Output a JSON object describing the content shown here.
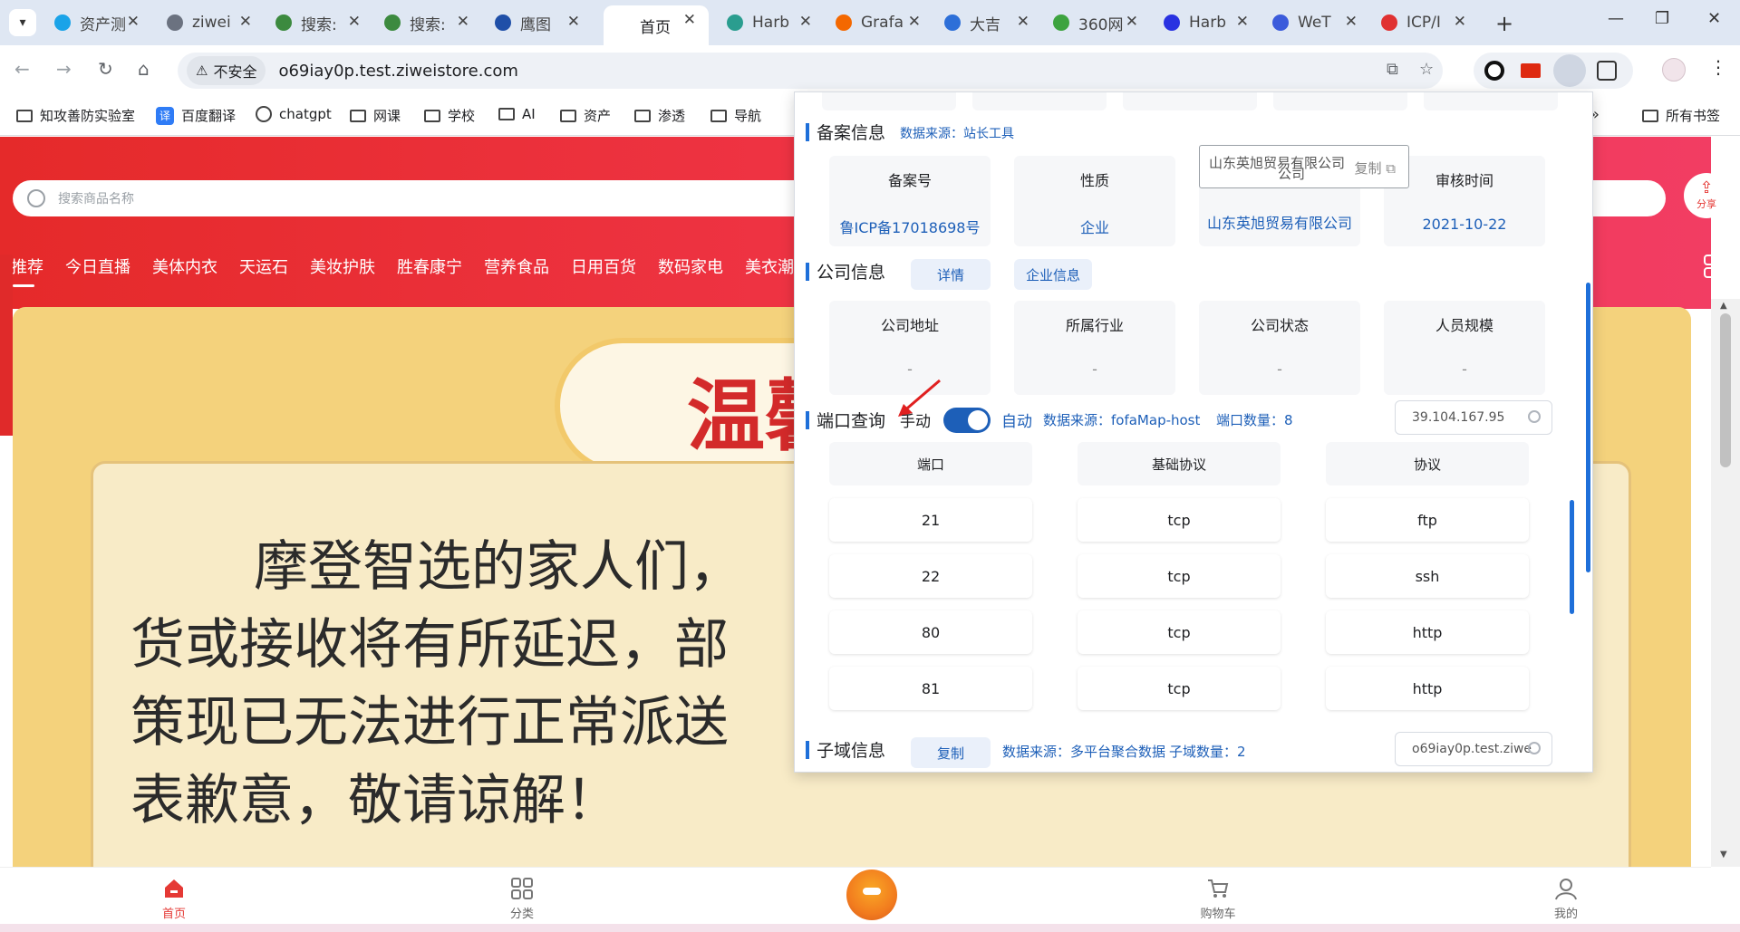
{
  "browser": {
    "tabs": [
      {
        "label": "资产测",
        "color": "#1aa3e8"
      },
      {
        "label": "ziwei",
        "color": "#6b7280"
      },
      {
        "label": "搜索:",
        "color": "#3c8a3f"
      },
      {
        "label": "搜索:",
        "color": "#3c8a3f"
      },
      {
        "label": "鹰图",
        "color": "#1f4fa8"
      },
      {
        "label": "首页",
        "color": "#ffffff"
      },
      {
        "label": "Harb",
        "color": "#2a9d8f"
      },
      {
        "label": "Grafa",
        "color": "#f46800"
      },
      {
        "label": "大吉",
        "color": "#2d6fd8"
      },
      {
        "label": "360网",
        "color": "#3da33f"
      },
      {
        "label": "Harb",
        "color": "#2932e1"
      },
      {
        "label": "WeT",
        "color": "#3b5bdb"
      },
      {
        "label": "ICP/I",
        "color": "#e03131"
      }
    ],
    "address": {
      "insecure_label": "不安全",
      "url": "o69iay0p.test.ziweistore.com"
    },
    "bookmarks": [
      "知攻善防实验室",
      "百度翻译",
      "chatgpt",
      "网课",
      "学校",
      "AI",
      "资产",
      "渗透",
      "导航"
    ],
    "bookmark_badge": "译",
    "all_bookmarks": "所有书签"
  },
  "page": {
    "search_placeholder": "搜索商品名称",
    "share_label": "分享",
    "categories": [
      "推荐",
      "今日直播",
      "美体内衣",
      "天运石",
      "美妆护肤",
      "胜春康宁",
      "营养食品",
      "日用百货",
      "数码家电",
      "美衣潮服"
    ],
    "banner": {
      "title_partial": "温馨",
      "lines": [
        "摩登智选的家人们，",
        "货或接收将有所延迟，部",
        "策现已无法进行正常派送",
        "表歉意，敬请谅解！"
      ]
    },
    "bottom_nav": [
      {
        "label": "首页",
        "active": true
      },
      {
        "label": "分类",
        "active": false
      },
      {
        "label": "购物车",
        "active": false
      },
      {
        "label": "我的",
        "active": false
      }
    ]
  },
  "popup": {
    "beian": {
      "title": "备案信息",
      "source": "数据来源：站长工具",
      "headers": [
        "备案号",
        "性质",
        "",
        "审核时间"
      ],
      "values": [
        "鲁ICP备17018698号",
        "企业",
        "山东英旭贸易有限公司",
        "2021-10-22"
      ],
      "tooltip_text": "山东英旭贸易有限公司",
      "tooltip_tail": "公司",
      "tooltip_copy": "复制"
    },
    "company": {
      "title": "公司信息",
      "btn_detail": "详情",
      "btn_enterprise": "企业信息",
      "headers": [
        "公司地址",
        "所属行业",
        "公司状态",
        "人员规模"
      ],
      "values": [
        "-",
        "-",
        "-",
        "-"
      ]
    },
    "ports": {
      "title": "端口查询",
      "manual": "手动",
      "auto": "自动",
      "source": "数据来源：fofaMap-host",
      "count": "端口数量：8",
      "search_value": "39.104.167.95",
      "headers": [
        "端口",
        "基础协议",
        "协议"
      ],
      "rows": [
        [
          "21",
          "tcp",
          "ftp"
        ],
        [
          "22",
          "tcp",
          "ssh"
        ],
        [
          "80",
          "tcp",
          "http"
        ],
        [
          "81",
          "tcp",
          "http"
        ]
      ]
    },
    "subdomain": {
      "title": "子域信息",
      "copy_btn": "复制",
      "source": "数据来源：多平台聚合数据",
      "count": "子域数量：2",
      "search_value": "o69iay0p.test.ziwe"
    }
  }
}
